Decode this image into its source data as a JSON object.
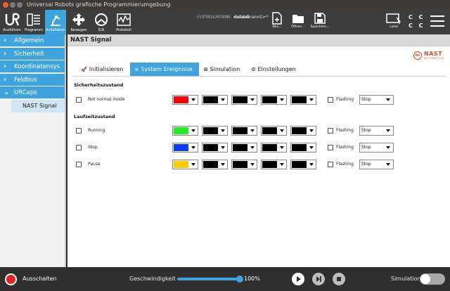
{
  "window": {
    "title": "Universal Robots grafische Programmierumgebung"
  },
  "nav": [
    {
      "label": "Ausführen",
      "icon": "ur-run-icon",
      "active": false
    },
    {
      "label": "Programm",
      "icon": "program-icon",
      "active": false
    },
    {
      "label": "Installation",
      "icon": "installation-icon",
      "active": true
    },
    {
      "label": "Bewegen",
      "icon": "move-icon",
      "active": false
    },
    {
      "label": "E/A",
      "icon": "io-icon",
      "active": false
    },
    {
      "label": "Protokoll",
      "icon": "log-icon",
      "active": false
    }
  ],
  "program": {
    "program_key": "PROGRAMM",
    "program_value": "<unbenannt>*",
    "install_key": "INSTALLATION",
    "install_value": "default"
  },
  "files": {
    "new": "Neu...",
    "open": "Öffnen...",
    "save": "Speichern..."
  },
  "status": {
    "lokal": "Lokal",
    "cc": "C C"
  },
  "sidebar": {
    "items": [
      {
        "label": "Allgemein"
      },
      {
        "label": "Sicherheit"
      },
      {
        "label": "Koordinatensys"
      },
      {
        "label": "Feldbus"
      },
      {
        "label": "URCaps"
      }
    ],
    "sub": {
      "label": "NAST Signal"
    }
  },
  "page": {
    "title": "NAST Signal"
  },
  "logo": {
    "name": "NAST",
    "sub": "AUTOMATION",
    "badge": "NS"
  },
  "tabs": [
    {
      "label": "Initialisieren",
      "icon": "rocket-icon",
      "glyph": "🚀"
    },
    {
      "label": "System Ereignisse",
      "icon": "list-icon",
      "glyph": "≡"
    },
    {
      "label": "Simulation",
      "icon": "simulation-icon",
      "glyph": "⊠"
    },
    {
      "label": "Einstellungen",
      "icon": "gear-icon",
      "glyph": "⚙"
    }
  ],
  "sections": {
    "safety": "Sicherheitszustand",
    "runtime": "Laufzeitzustand"
  },
  "rows": [
    {
      "label": "Not normal mode",
      "colors": [
        "#ff0000",
        "#000000",
        "#000000",
        "#000000",
        "#000000"
      ],
      "flashing": "Flashing",
      "action": "Stop"
    },
    {
      "label": "Running",
      "colors": [
        "#22ee22",
        "#000000",
        "#000000",
        "#000000",
        "#000000"
      ],
      "flashing": "Flashing",
      "action": "Stop"
    },
    {
      "label": "Stop",
      "colors": [
        "#0a3cff",
        "#000000",
        "#000000",
        "#000000",
        "#000000"
      ],
      "flashing": "Flashing",
      "action": "Stop"
    },
    {
      "label": "Pause",
      "colors": [
        "#ffcc00",
        "#000000",
        "#000000",
        "#000000",
        "#000000"
      ],
      "flashing": "Flashing",
      "action": "Stop"
    }
  ],
  "footer": {
    "power_label": "Ausschalten",
    "speed_label": "Geschwindigkeit",
    "speed_value": "100%",
    "speed_fraction": 1.0,
    "sim_label": "Simulation"
  },
  "colors": {
    "accent": "#3fa3dd",
    "power": "#e02424",
    "logo": "#d94b2b"
  }
}
